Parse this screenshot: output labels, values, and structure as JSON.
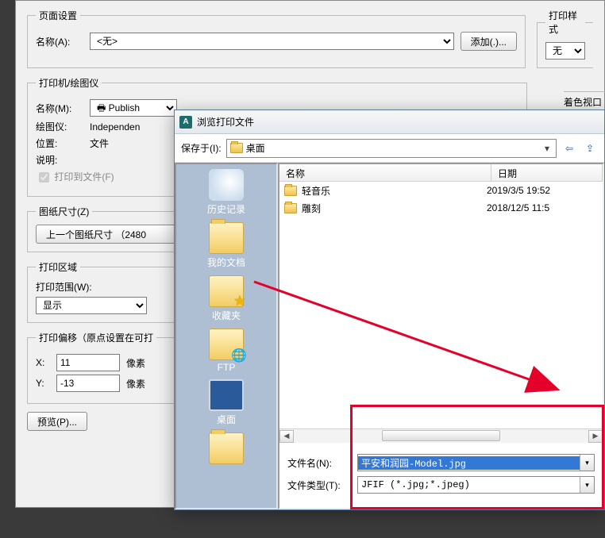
{
  "page_setup": {
    "legend": "页面设置",
    "name_label": "名称(A):",
    "name_value": "<无>",
    "add_btn": "添加(.)..."
  },
  "print_style": {
    "legend": "打印样式",
    "value": "无"
  },
  "printer": {
    "legend": "打印机/绘图仪",
    "name_label": "名称(M):",
    "name_value": "Publish",
    "plotter_label": "绘图仪:",
    "plotter_value": "Independen",
    "location_label": "位置:",
    "location_value": "文件",
    "desc_label": "说明:",
    "print_to_file": "打印到文件(F)"
  },
  "color_viewport": {
    "legend": "着色视口"
  },
  "paper": {
    "legend": "图纸尺寸(Z)",
    "btn": "上一个图纸尺寸 （2480"
  },
  "print_area": {
    "legend": "打印区域",
    "range_label": "打印范围(W):",
    "range_value": "显示"
  },
  "print_offset": {
    "legend": "打印偏移（原点设置在可打",
    "x_label": "X:",
    "x_value": "11",
    "y_label": "Y:",
    "y_value": "-13",
    "unit": "像素"
  },
  "preview_btn": "预览(P)...",
  "browse": {
    "title": "浏览打印文件",
    "savein_label": "保存于(I):",
    "savein_value": "桌面",
    "places": {
      "history": "历史记录",
      "mydocs": "我的文档",
      "favorites": "收藏夹",
      "ftp": "FTP",
      "desktop": "桌面"
    },
    "cols": {
      "name": "名称",
      "date": "日期"
    },
    "rows": [
      {
        "name": "轻音乐",
        "date": "2019/3/5 19:52"
      },
      {
        "name": "雕刻",
        "date": "2018/12/5 11:5"
      }
    ],
    "filename_label": "文件名(N):",
    "filename_value": "平安和润园-Model.jpg",
    "filetype_label": "文件类型(T):",
    "filetype_value": "JFIF (*.jpg;*.jpeg)"
  }
}
